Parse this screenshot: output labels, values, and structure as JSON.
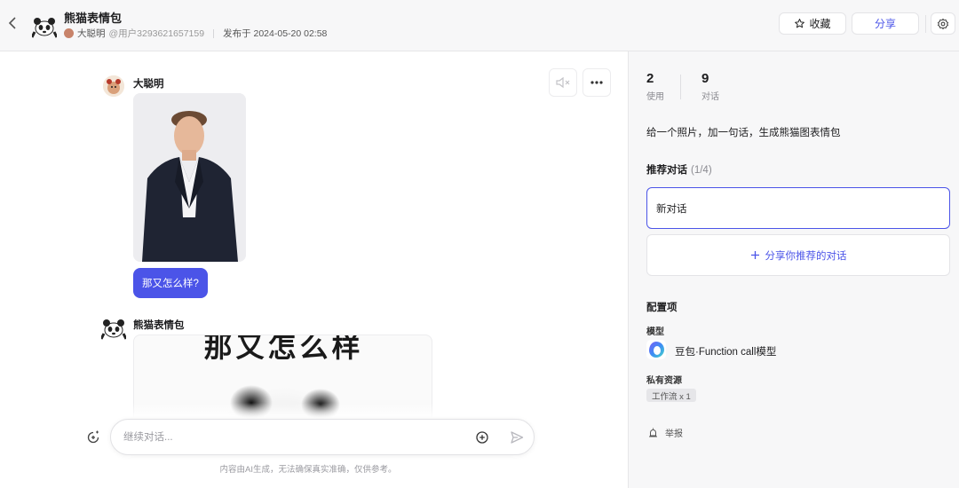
{
  "header": {
    "title": "熊猫表情包",
    "author": "大聪明",
    "handle": "@用户3293621657159",
    "published": "发布于 2024-05-20 02:58",
    "fav_label": "收藏",
    "share_label": "分享"
  },
  "chat": {
    "user_name": "大聪明",
    "user_message": "那又怎么样?",
    "bot_name": "熊猫表情包",
    "meme_caption": "那又怎么样",
    "input_placeholder": "继续对话...",
    "disclaimer": "内容由AI生成，无法确保真实准确，仅供参考。"
  },
  "panel": {
    "stats": [
      {
        "value": "2",
        "label": "使用"
      },
      {
        "value": "9",
        "label": "对话"
      }
    ],
    "description": "给一个照片，加一句话，生成熊猫图表情包",
    "recommend_title": "推荐对话",
    "recommend_count": "(1/4)",
    "recommend_item": "新对话",
    "recommend_add": "分享你推荐的对话",
    "config_title": "配置项",
    "model_label": "模型",
    "model_name": "豆包·Function call模型",
    "resource_label": "私有资源",
    "resource_tag": "工作流 x 1",
    "report_label": "举报"
  },
  "colors": {
    "accent": "#4b54e8",
    "panel_bg": "#f7f7f8"
  }
}
